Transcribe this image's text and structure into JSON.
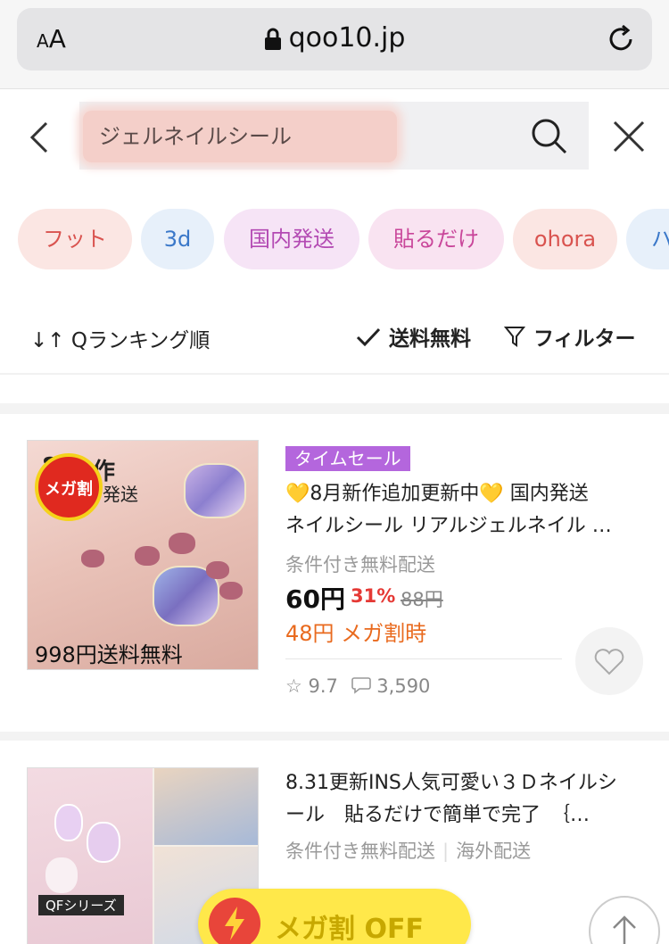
{
  "browser": {
    "text_size_label_small": "A",
    "text_size_label_large": "A",
    "url": "qoo10.jp"
  },
  "search": {
    "query": "ジェルネイルシール"
  },
  "chips": [
    {
      "label": "フット",
      "bg": "#fbe6e3",
      "color": "#d9534f"
    },
    {
      "label": "3d",
      "bg": "#e7f0fa",
      "color": "#3a78c9"
    },
    {
      "label": "国内発送",
      "bg": "#f6e4f6",
      "color": "#b34ab3"
    },
    {
      "label": "貼るだけ",
      "bg": "#f9e3f1",
      "color": "#c9469a"
    },
    {
      "label": "ohora",
      "bg": "#fbe6e3",
      "color": "#d9534f"
    },
    {
      "label": "ハ",
      "bg": "#e7f0fa",
      "color": "#3a78c9"
    }
  ],
  "sort": {
    "ranking_label": "Qランキング順",
    "free_shipping_label": "送料無料",
    "filter_label": "フィルター"
  },
  "products": [
    {
      "badge": "タイムセール",
      "title_line1": "💛8月新作追加更新中💛 国内発送",
      "title_line2": "ネイルシール リアルジェルネイル …",
      "shipping": "条件付き無料配送",
      "price": "60円",
      "discount": "31%",
      "original_price": "88円",
      "mega_price": "48円 メガ割時",
      "rating": "9.7",
      "reviews": "3,590",
      "thumb_mega_badge": "メガ割",
      "thumb_top_text1": "8",
      "thumb_top_text2": "作",
      "thumb_top_text3": "発送",
      "thumb_bottom_text": "998円送料無料"
    },
    {
      "title_line1": "8.31更新INS人気可愛い３Ｄネイルシ",
      "title_line2": "ール　貼るだけで簡単で完了　｛…",
      "shipping": "条件付き無料配送",
      "shipping_origin": "海外配送",
      "thumb_label": "QFシリーズ"
    }
  ],
  "floating": {
    "mega_off_label": "メガ割 OFF"
  },
  "colors": {
    "timesale": "#b466dd",
    "discount": "#e53935",
    "mega": "#e96a1e",
    "mega_button": "#ffe84a"
  }
}
